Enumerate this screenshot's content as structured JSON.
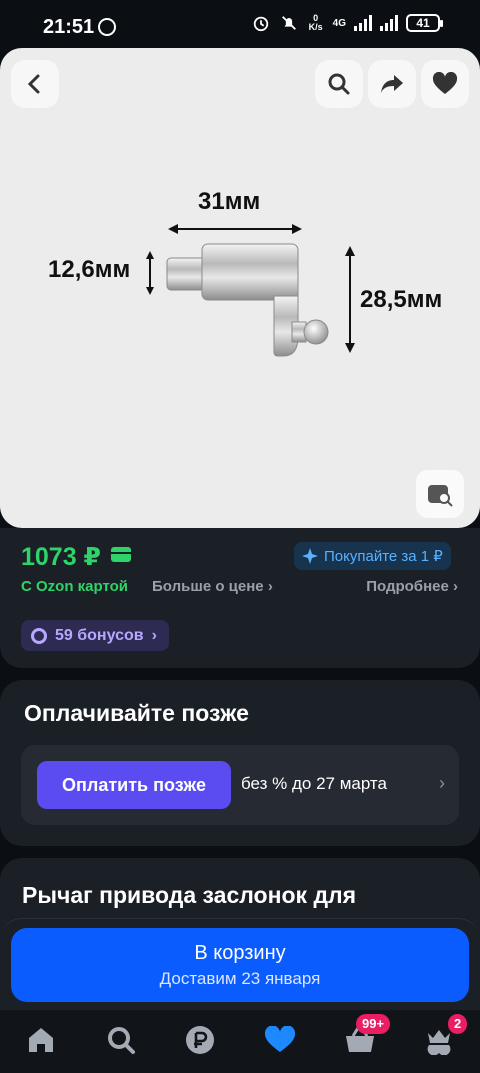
{
  "status_bar": {
    "time": "21:51",
    "net_speed_value": "0",
    "net_speed_unit": "K/s",
    "network": "4G",
    "battery": "41"
  },
  "image": {
    "dim_width": "31мм",
    "dim_diameter": "12,6мм",
    "dim_height": "28,5мм"
  },
  "price": {
    "value": "1073 ₽",
    "promo": "Покупайте за 1 ₽",
    "ozon_card": "С Ozon картой",
    "more_price": "Больше о цене",
    "details": "Подробнее",
    "bonus": "59 бонусов",
    "color_green": "#2ed36a"
  },
  "pay_later": {
    "title": "Оплачивайте позже",
    "button": "Оплатить позже",
    "text": "без % до 27 марта",
    "color_accent": "#5a4cf0"
  },
  "product": {
    "title": "Рычаг привода заслонок для"
  },
  "cart": {
    "label": "В корзину",
    "delivery": "Доставим 23 января",
    "color": "#0a5cff"
  },
  "nav": {
    "cart_badge": "99+",
    "profile_badge": "2",
    "items": [
      "home-icon",
      "search-icon",
      "ruble-icon",
      "heart-icon",
      "basket-icon",
      "profile-icon"
    ]
  }
}
